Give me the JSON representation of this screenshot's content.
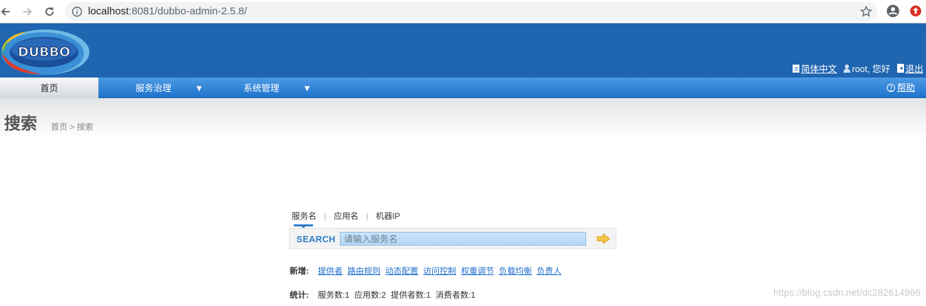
{
  "browser": {
    "url_host": "localhost",
    "url_rest": ":8081/dubbo-admin-2.5.8/"
  },
  "header": {
    "logo_text": "DUBBO",
    "language_link": "简体中文",
    "user_greeting": "root, 您好",
    "logout_link": "退出"
  },
  "menu": {
    "items": [
      {
        "label": "首页"
      },
      {
        "label": "服务治理"
      },
      {
        "label": "系统管理"
      }
    ],
    "help": "帮助"
  },
  "page": {
    "title": "搜索",
    "breadcrumb": "首页 > 搜索"
  },
  "search": {
    "tabs": [
      "服务名",
      "应用名",
      "机器IP"
    ],
    "label": "SEARCH",
    "placeholder": "请输入服务名"
  },
  "add_row": {
    "label": "新增:",
    "links": [
      "提供者",
      "路由规则",
      "动态配置",
      "访问控制",
      "权重调节",
      "负载均衡",
      "负责人"
    ]
  },
  "stats_row": {
    "label": "统计:",
    "items": [
      "服务数:1",
      "应用数:2",
      "提供者数:1",
      "消费者数:1"
    ]
  },
  "watermark": "https://blog.csdn.net/dc282614966",
  "colors": {
    "header_bg": "#2065b0",
    "menu_top": "#4d9ae4",
    "accent": "#2d7ec5",
    "link": "#1f6fcb"
  }
}
